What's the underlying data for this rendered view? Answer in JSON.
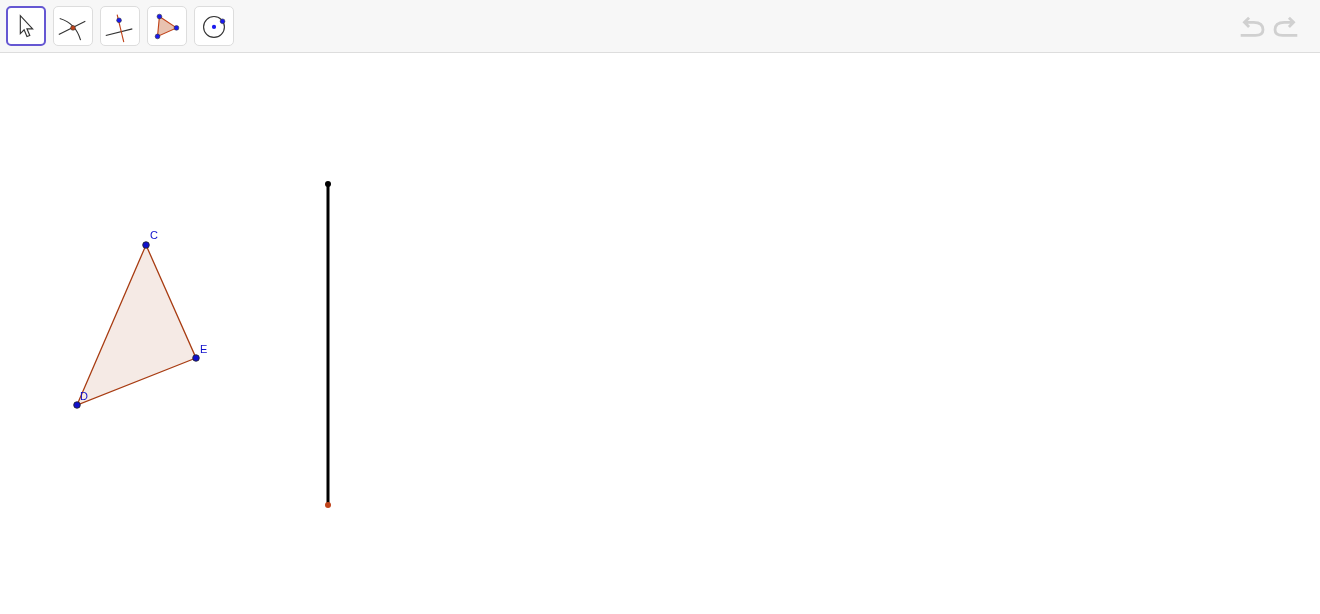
{
  "toolbar": {
    "tools": [
      {
        "kind": "move",
        "selected": true
      },
      {
        "kind": "intersect",
        "selected": false
      },
      {
        "kind": "perpendicular",
        "selected": false
      },
      {
        "kind": "polygon",
        "selected": false
      },
      {
        "kind": "circle",
        "selected": false
      }
    ],
    "undo": {
      "disabled": true
    },
    "redo": {
      "disabled": true
    }
  },
  "canvas": {
    "triangle": {
      "points": [
        {
          "label": "C"
        },
        {
          "label": "E"
        },
        {
          "label": "D"
        }
      ]
    },
    "segment": {
      "endpoints": [
        {
          "color": "#000000"
        },
        {
          "color": "#c0431a"
        }
      ]
    }
  }
}
